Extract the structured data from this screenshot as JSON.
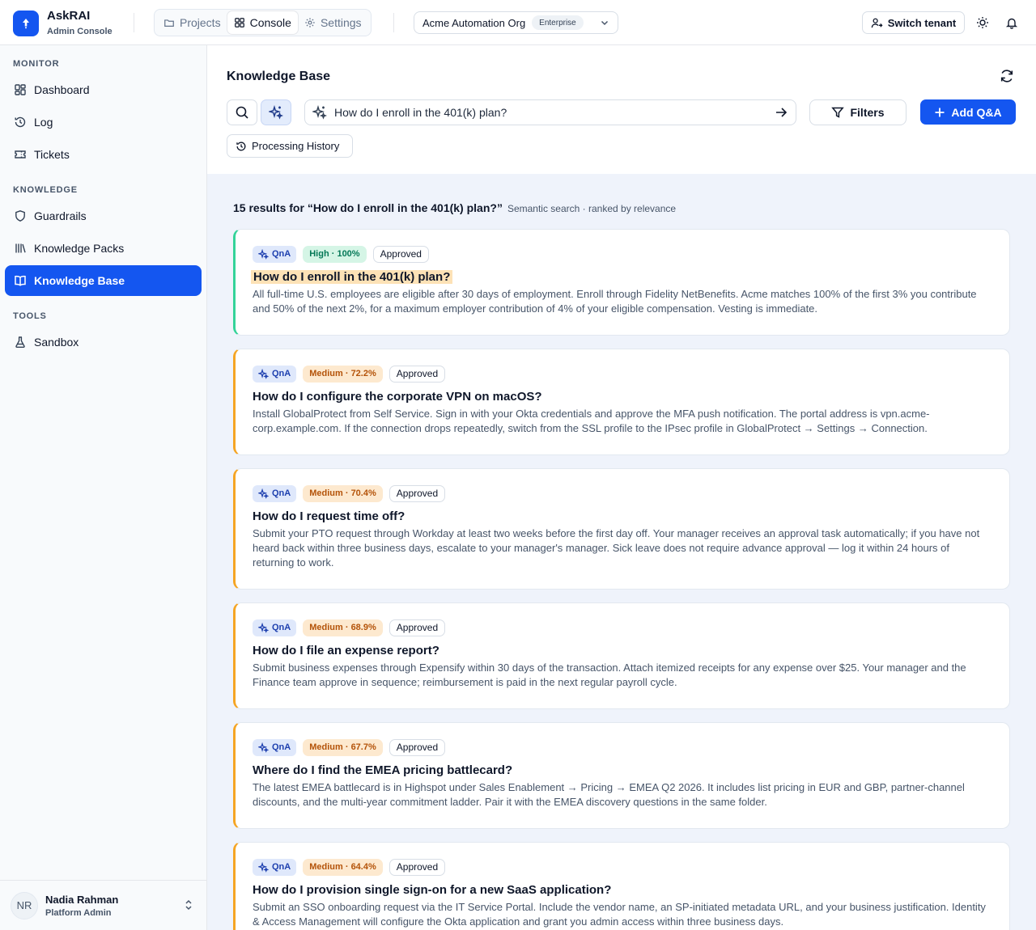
{
  "brand": {
    "name": "AskRAI",
    "subtitle": "Admin Console"
  },
  "topnav": {
    "projects": "Projects",
    "console": "Console",
    "settings": "Settings"
  },
  "org": {
    "name": "Acme Automation Org",
    "plan": "Enterprise"
  },
  "header_actions": {
    "switch_tenant": "Switch tenant"
  },
  "sidebar": {
    "sections": [
      {
        "label": "MONITOR",
        "items": [
          {
            "label": "Dashboard",
            "icon": "dashboard-icon"
          },
          {
            "label": "Log",
            "icon": "history-icon"
          },
          {
            "label": "Tickets",
            "icon": "ticket-icon"
          }
        ]
      },
      {
        "label": "KNOWLEDGE",
        "items": [
          {
            "label": "Guardrails",
            "icon": "shield-icon"
          },
          {
            "label": "Knowledge Packs",
            "icon": "library-icon"
          },
          {
            "label": "Knowledge Base",
            "icon": "book-icon",
            "active": true
          }
        ]
      },
      {
        "label": "TOOLS",
        "items": [
          {
            "label": "Sandbox",
            "icon": "flask-icon"
          }
        ]
      }
    ],
    "user": {
      "initials": "NR",
      "name": "Nadia Rahman",
      "role": "Platform Admin"
    }
  },
  "page": {
    "title": "Knowledge Base",
    "search": {
      "query": "How do I enroll in the 401(k) plan?"
    },
    "filters_label": "Filters",
    "add_label": "Add Q&A",
    "history_label": "Processing History"
  },
  "results": {
    "summary": "15 results for “How do I enroll in the 401(k) plan?”",
    "summary_sub": "Semantic search · ranked by relevance",
    "items": [
      {
        "type": "QnA",
        "confidence": "High · 100%",
        "status": "Approved",
        "question": "How do I enroll in the 401(k) plan?",
        "answer": "All full-time U.S. employees are eligible after 30 days of employment. Enroll through Fidelity NetBenefits. Acme matches 100% of the first 3% you contribute and 50% of the next 2%, for a maximum employer contribution of 4% of your eligible compensation. Vesting is immediate."
      },
      {
        "type": "QnA",
        "confidence": "Medium · 72.2%",
        "status": "Approved",
        "question": "How do I configure the corporate VPN on macOS?",
        "answer": "Install GlobalProtect from Self Service. Sign in with your Okta credentials and approve the MFA push notification. The portal address is vpn.acme-corp.example.com. If the connection drops repeatedly, switch from the SSL profile to the IPsec profile in GlobalProtect → Settings → Connection."
      },
      {
        "type": "QnA",
        "confidence": "Medium · 70.4%",
        "status": "Approved",
        "question": "How do I request time off?",
        "answer": "Submit your PTO request through Workday at least two weeks before the first day off. Your manager receives an approval task automatically; if you have not heard back within three business days, escalate to your manager's manager. Sick leave does not require advance approval — log it within 24 hours of returning to work."
      },
      {
        "type": "QnA",
        "confidence": "Medium · 68.9%",
        "status": "Approved",
        "question": "How do I file an expense report?",
        "answer": "Submit business expenses through Expensify within 30 days of the transaction. Attach itemized receipts for any expense over $25. Your manager and the Finance team approve in sequence; reimbursement is paid in the next regular payroll cycle."
      },
      {
        "type": "QnA",
        "confidence": "Medium · 67.7%",
        "status": "Approved",
        "question": "Where do I find the EMEA pricing battlecard?",
        "answer": "The latest EMEA battlecard is in Highspot under Sales Enablement → Pricing → EMEA Q2 2026. It includes list pricing in EUR and GBP, partner-channel discounts, and the multi-year commitment ladder. Pair it with the EMEA discovery questions in the same folder."
      },
      {
        "type": "QnA",
        "confidence": "Medium · 64.4%",
        "status": "Approved",
        "question": "How do I provision single sign-on for a new SaaS application?",
        "answer": "Submit an SSO onboarding request via the IT Service Portal. Include the vendor name, an SP-initiated metadata URL, and your business justification. Identity & Access Management will configure the Okta application and grant you admin access within three business days."
      }
    ]
  }
}
